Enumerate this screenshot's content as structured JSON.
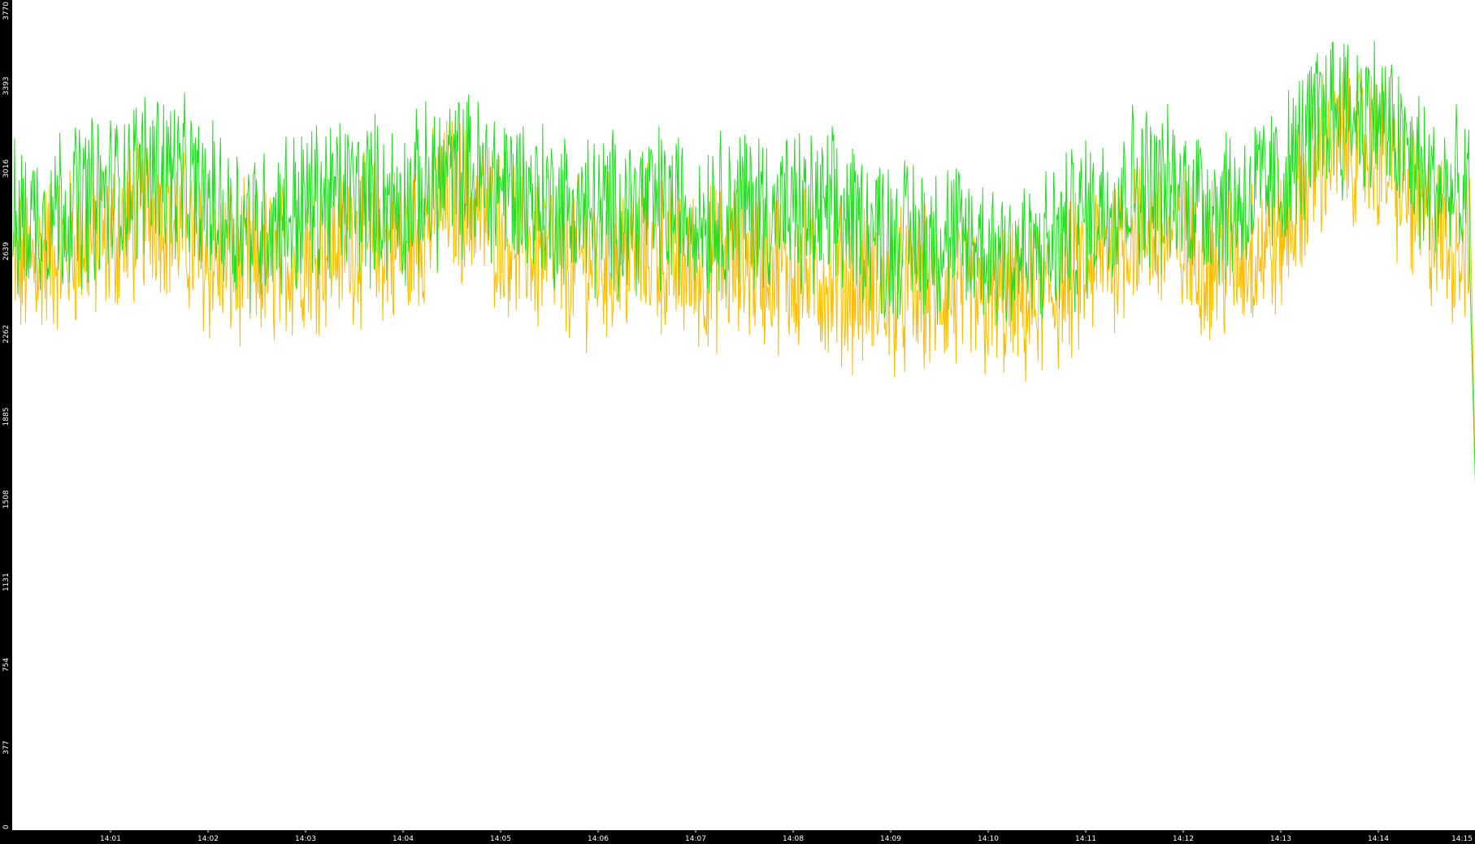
{
  "chart_data": {
    "type": "line",
    "title": "",
    "xlabel": "",
    "ylabel": "",
    "ylim": [
      0,
      3770
    ],
    "y_ticks": [
      "0",
      "377",
      "754",
      "1131",
      "1508",
      "1885",
      "2262",
      "2639",
      "3016",
      "3393",
      "3770"
    ],
    "x_ticks": [
      "14:01",
      "14:02",
      "14:03",
      "14:04",
      "14:05",
      "14:06",
      "14:07",
      "14:08",
      "14:09",
      "14:10",
      "14:11",
      "14:12",
      "14:13",
      "14:14",
      "14:15"
    ],
    "x_range_minutes": [
      0,
      15
    ],
    "grid": false,
    "legend": "none",
    "axis_background": "#000000",
    "axis_text_color": "#ffffff",
    "series": [
      {
        "color": "#22dd22",
        "x_minutes": [
          0,
          0.5,
          1.0,
          1.5,
          2.0,
          2.5,
          3.0,
          3.5,
          4.0,
          4.5,
          5.0,
          5.5,
          6.0,
          6.5,
          7.0,
          7.5,
          8.0,
          8.5,
          9.0,
          9.5,
          10.0,
          10.5,
          11.0,
          11.5,
          12.0,
          12.5,
          13.0,
          13.5,
          14.0,
          14.5,
          14.95,
          15.0
        ],
        "values": [
          2750,
          2850,
          2900,
          3050,
          2850,
          2750,
          2850,
          2900,
          2850,
          3000,
          2950,
          2850,
          2800,
          2850,
          2800,
          2850,
          2800,
          2800,
          2700,
          2700,
          2650,
          2600,
          2800,
          2950,
          2900,
          2850,
          2950,
          3300,
          3250,
          2950,
          2850,
          1500
        ]
      },
      {
        "color": "#ffbb00",
        "x_minutes": [
          0,
          0.5,
          1.0,
          1.5,
          2.0,
          2.5,
          3.0,
          3.5,
          4.0,
          4.5,
          5.0,
          5.5,
          6.0,
          6.5,
          7.0,
          7.5,
          8.0,
          8.5,
          9.0,
          9.5,
          10.0,
          10.5,
          11.0,
          11.5,
          12.0,
          12.5,
          13.0,
          13.5,
          14.0,
          14.5,
          14.95,
          15.0
        ],
        "values": [
          2550,
          2650,
          2700,
          2850,
          2600,
          2550,
          2650,
          2700,
          2650,
          2900,
          2750,
          2600,
          2600,
          2650,
          2550,
          2600,
          2550,
          2500,
          2450,
          2450,
          2400,
          2400,
          2550,
          2750,
          2650,
          2600,
          2700,
          3150,
          3100,
          2750,
          2650,
          1500
        ]
      }
    ]
  }
}
